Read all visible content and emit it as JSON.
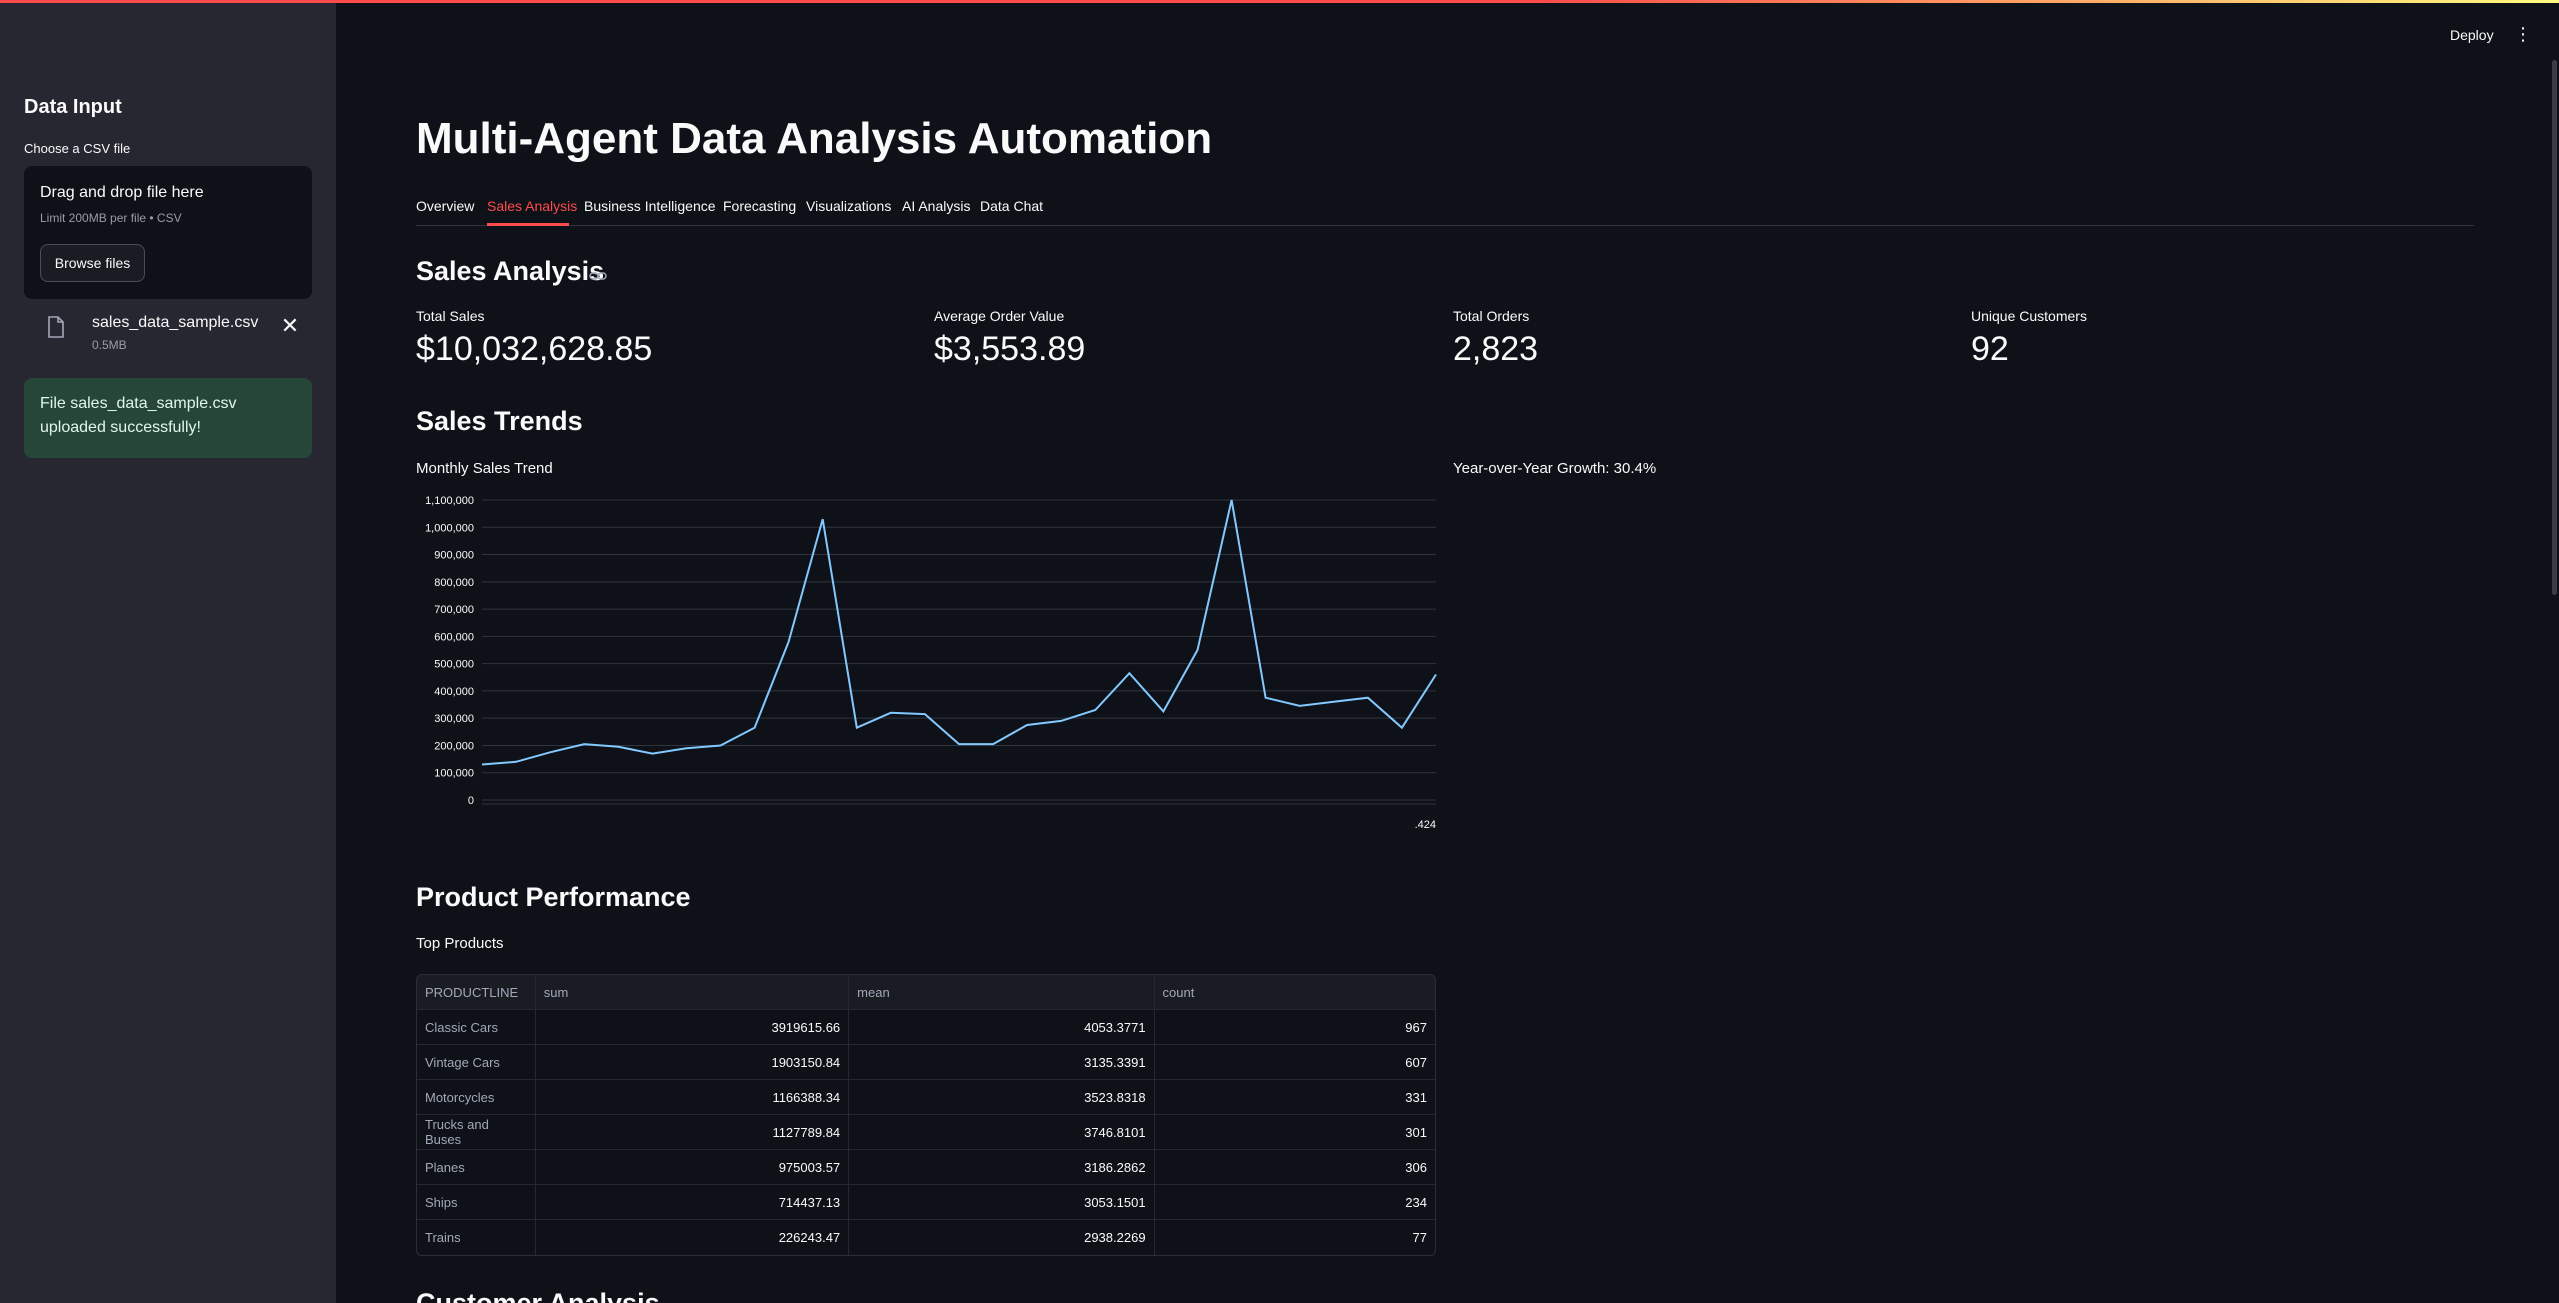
{
  "sidebar": {
    "title": "Data Input",
    "uploader_label": "Choose a CSV file",
    "dropzone_title": "Drag and drop file here",
    "dropzone_limit": "Limit 200MB per file • CSV",
    "browse_label": "Browse files",
    "file_name": "sales_data_sample.csv",
    "file_size": "0.5MB",
    "success_message": "File sales_data_sample.csv uploaded successfully!"
  },
  "header": {
    "deploy_label": "Deploy",
    "menu_glyph": "⋮"
  },
  "main": {
    "title": "Multi-Agent Data Analysis Automation",
    "tabs": [
      {
        "label": "Overview",
        "active": false
      },
      {
        "label": "Sales Analysis",
        "active": true
      },
      {
        "label": "Business Intelligence",
        "active": false
      },
      {
        "label": "Forecasting",
        "active": false
      },
      {
        "label": "Visualizations",
        "active": false
      },
      {
        "label": "AI Analysis",
        "active": false
      },
      {
        "label": "Data Chat",
        "active": false
      }
    ],
    "section_title": "Sales Analysis",
    "metrics": [
      {
        "label": "Total Sales",
        "value": "$10,032,628.85"
      },
      {
        "label": "Average Order Value",
        "value": "$3,553.89"
      },
      {
        "label": "Total Orders",
        "value": "2,823"
      },
      {
        "label": "Unique Customers",
        "value": "92"
      }
    ],
    "trends_title": "Sales Trends",
    "chart_title": "Monthly Sales Trend",
    "yoy_growth": "Year-over-Year Growth: 30.4%",
    "product_title": "Product Performance",
    "top_products_title": "Top Products",
    "next_section_title": "Customer Analysis"
  },
  "table": {
    "columns": [
      "PRODUCTLINE",
      "sum",
      "mean",
      "count"
    ],
    "rows": [
      [
        "Classic Cars",
        "3919615.66",
        "4053.3771",
        "967"
      ],
      [
        "Vintage Cars",
        "1903150.84",
        "3135.3391",
        "607"
      ],
      [
        "Motorcycles",
        "1166388.34",
        "3523.8318",
        "331"
      ],
      [
        "Trucks and Buses",
        "1127789.84",
        "3746.8101",
        "301"
      ],
      [
        "Planes",
        "975003.57",
        "3186.2862",
        "306"
      ],
      [
        "Ships",
        "714437.13",
        "3053.1501",
        "234"
      ],
      [
        "Trains",
        "226243.47",
        "2938.2269",
        "77"
      ]
    ]
  },
  "chart_data": {
    "type": "line",
    "title": "Monthly Sales Trend",
    "xlabel": "",
    "ylabel": "",
    "x_tick_labels": [
      ".424"
    ],
    "y_ticks": [
      "0",
      "100,000",
      "200,000",
      "300,000",
      "400,000",
      "500,000",
      "600,000",
      "700,000",
      "800,000",
      "900,000",
      "1,000,000",
      "1,100,000"
    ],
    "ylim": [
      0,
      1100000
    ],
    "series": [
      {
        "color": "#83c9ff",
        "values": [
          130000,
          140000,
          175000,
          205000,
          195000,
          170000,
          190000,
          200000,
          265000,
          580000,
          1030000,
          265000,
          320000,
          315000,
          205000,
          205000,
          275000,
          290000,
          330000,
          465000,
          325000,
          550000,
          1100000,
          375000,
          345000,
          360000,
          375000,
          265000,
          460000
        ]
      }
    ],
    "grid": true
  }
}
